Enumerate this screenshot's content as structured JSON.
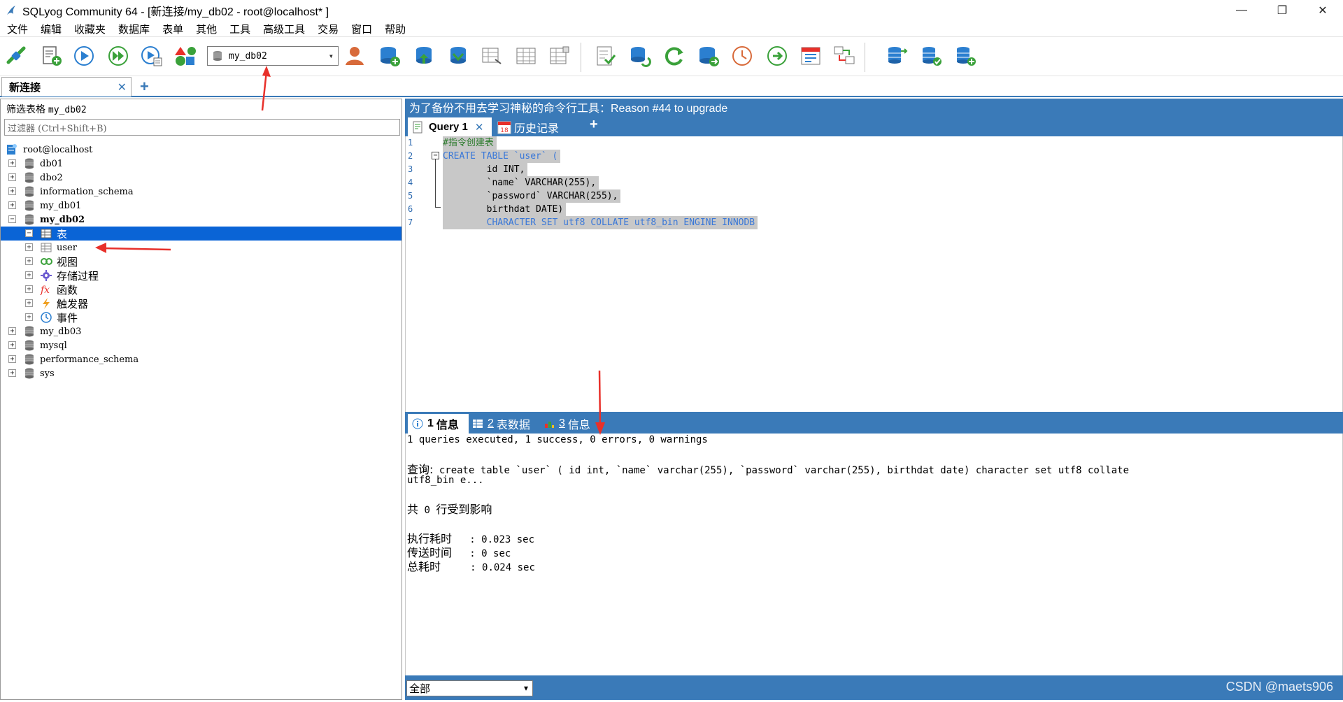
{
  "window": {
    "title": "SQLyog Community 64 - [新连接/my_db02 - root@localhost* ]",
    "minimize": "—",
    "restore": "❐",
    "close": "✕"
  },
  "menu": [
    "文件",
    "编辑",
    "收藏夹",
    "数据库",
    "表单",
    "其他",
    "工具",
    "高级工具",
    "交易",
    "窗口",
    "帮助"
  ],
  "toolbar": {
    "database_select": "my_db02",
    "icons": [
      "connect-icon",
      "new-query-icon",
      "execute-query-icon",
      "execute-all-icon",
      "execute-edit-icon",
      "schema-designer-icon",
      "user-manager-icon",
      "create-database-icon",
      "create-table-icon",
      "copy-database-icon",
      "import-icon",
      "table-data-icon",
      "table-structure-icon",
      "table-diagnostics-icon",
      "query-builder-icon",
      "sync-schema-icon",
      "refresh-icon",
      "backup-icon",
      "scheduler-icon",
      "execute-script-icon",
      "notifications-icon",
      "data-compare-icon",
      "db-sync-icon",
      "db-sync-2-icon",
      "db-sync-3-icon"
    ]
  },
  "connection_tab": {
    "label": "新连接",
    "close": "✕",
    "add": "+"
  },
  "object_browser": {
    "filter_label_prefix": "筛选表格",
    "filter_label_db": "my_db02",
    "filter_placeholder": "过滤器 (Ctrl+Shift+B)",
    "tree": [
      {
        "label": "root@localhost",
        "level": 0,
        "icon": "server-icon",
        "expander": ""
      },
      {
        "label": "db01",
        "level": 1,
        "icon": "database-icon",
        "expander": "+"
      },
      {
        "label": "dbo2",
        "level": 1,
        "icon": "database-icon",
        "expander": "+"
      },
      {
        "label": "information_schema",
        "level": 1,
        "icon": "database-icon",
        "expander": "+"
      },
      {
        "label": "my_db01",
        "level": 1,
        "icon": "database-icon",
        "expander": "+"
      },
      {
        "label": "my_db02",
        "level": 1,
        "icon": "database-icon",
        "expander": "−",
        "bold": true
      },
      {
        "label": "表",
        "level": 2,
        "icon": "tables-icon",
        "expander": "−",
        "selected": true
      },
      {
        "label": "user",
        "level": 3,
        "icon": "table-icon",
        "expander": "+"
      },
      {
        "label": "视图",
        "level": 2,
        "icon": "views-icon",
        "expander": "+"
      },
      {
        "label": "存储过程",
        "level": 2,
        "icon": "procedures-icon",
        "expander": "+"
      },
      {
        "label": "函数",
        "level": 2,
        "icon": "functions-icon",
        "expander": "+"
      },
      {
        "label": "触发器",
        "level": 2,
        "icon": "triggers-icon",
        "expander": "+"
      },
      {
        "label": "事件",
        "level": 2,
        "icon": "events-icon",
        "expander": "+"
      },
      {
        "label": "my_db03",
        "level": 1,
        "icon": "database-icon",
        "expander": "+"
      },
      {
        "label": "mysql",
        "level": 1,
        "icon": "database-icon",
        "expander": "+"
      },
      {
        "label": "performance_schema",
        "level": 1,
        "icon": "database-icon",
        "expander": "+"
      },
      {
        "label": "sys",
        "level": 1,
        "icon": "database-icon",
        "expander": "+"
      }
    ]
  },
  "banner": "为了备份不用去学习神秘的命令行工具：Reason #44 to upgrade",
  "query_tabs": {
    "query": "Query 1",
    "close": "✕",
    "history": "历史记录",
    "add": "+"
  },
  "editor": {
    "lines": [
      {
        "n": "1",
        "text": "#指令创建表"
      },
      {
        "n": "2",
        "text": "CREATE TABLE `user` ("
      },
      {
        "n": "3",
        "text": "        id INT,"
      },
      {
        "n": "4",
        "text": "        `name` VARCHAR(255),"
      },
      {
        "n": "5",
        "text": "        `password` VARCHAR(255),"
      },
      {
        "n": "6",
        "text": "        birthdat DATE)"
      },
      {
        "n": "7",
        "text": "        CHARACTER SET utf8 COLLATE utf8_bin ENGINE INNODB"
      }
    ]
  },
  "result_tabs": [
    {
      "num": "1",
      "label": "信息"
    },
    {
      "num": "2",
      "label": "表数据"
    },
    {
      "num": "3",
      "label": "信息"
    }
  ],
  "results": {
    "summary": "1 queries executed, 1 success, 0 errors, 0 warnings",
    "query_label": "查询:",
    "query_text": " create table `user` ( id int, `name` varchar(255), `password` varchar(255), birthdat date) character set utf8 collate",
    "query_text_2": "utf8_bin e...",
    "affected_prefix": "共",
    "affected_count": "0",
    "affected_suffix": "行受到影响",
    "exec_label": "执行耗时",
    "exec_value": "   : 0.023 sec",
    "transfer_label": "传送时间",
    "transfer_value": "   : 0 sec",
    "total_label": "总耗时",
    "total_value": "     : 0.024 sec"
  },
  "footer": {
    "filter_select": "全部",
    "watermark": "CSDN @maets906"
  },
  "colors": {
    "accent_blue": "#3a7ab8",
    "selection_blue": "#0a64d6",
    "annotation_red": "#e8302a"
  }
}
